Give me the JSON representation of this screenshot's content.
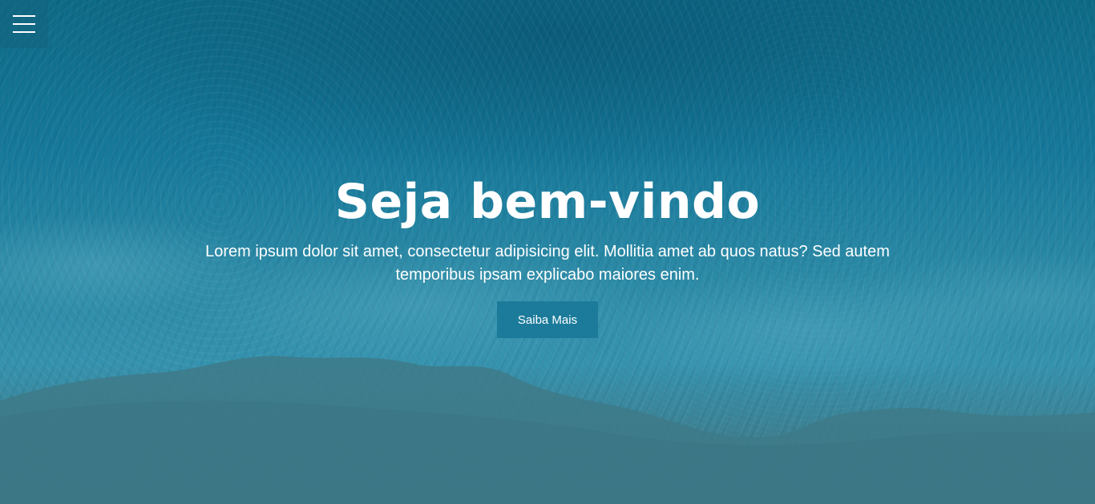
{
  "nav": {
    "menu_icon": "hamburger-menu-icon"
  },
  "hero": {
    "title": "Seja bem-vindo",
    "subtitle": "Lorem ipsum dolor sit amet, consectetur adipisicing elit. Mollitia amet ab quos natus? Sed autem temporibus ipsam explicabo maiores enim.",
    "button_label": "Saiba Mais"
  },
  "colors": {
    "ocean_deep": "#0d6a86",
    "ocean_light": "#3592ae",
    "sand_water": "#3e7a88",
    "button_bg": "#1c7b9a",
    "text": "#ffffff"
  }
}
